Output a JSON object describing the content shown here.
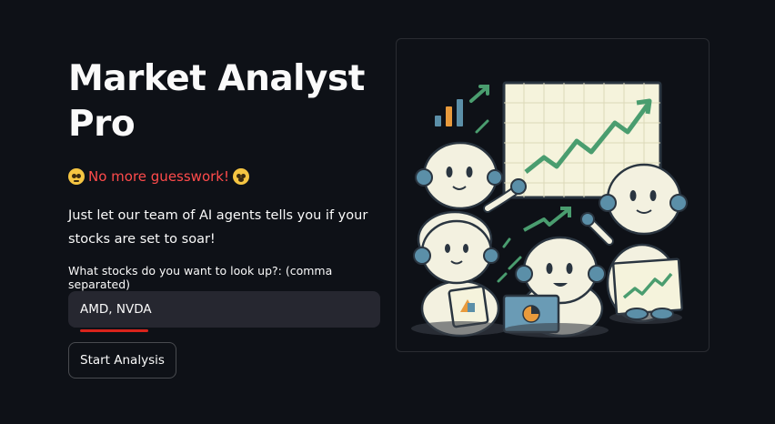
{
  "header": {
    "title": "Market Analyst Pro"
  },
  "tagline": {
    "text": "No more guesswork!",
    "leading_emoji": "face-with-spiral-eyes-icon",
    "trailing_emoji": "dizzy-face-icon",
    "color": "#ff4b4b"
  },
  "description": "Just let our team of AI agents tells you if your stocks are set to soar!",
  "stock_input": {
    "label": "What stocks do you want to look up?: (comma separated)",
    "value": "AMD, NVDA"
  },
  "start_button": {
    "label": "Start Analysis"
  },
  "illustration": {
    "icon": "robots-analyzing-charts-illustration"
  },
  "colors": {
    "background": "#0e1117",
    "input_background": "#262730",
    "accent": "#ff4b4b",
    "chart_green": "#4a9d6f",
    "robot_body": "#f3f1e0",
    "robot_accent": "#5b8fa8"
  }
}
